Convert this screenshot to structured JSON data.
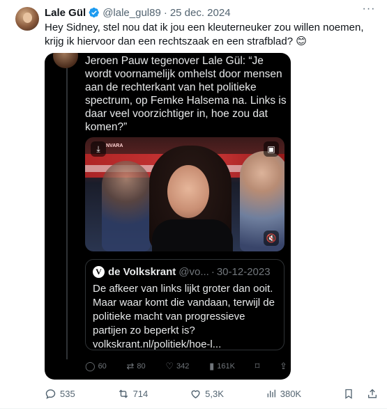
{
  "tweet": {
    "author_name": "Lale Gül",
    "handle": "@lale_gul89",
    "separator": "·",
    "date": "25 dec. 2024",
    "text": "Hey Sidney, stel nou dat ik jou een kleuterneuker zou willen noemen, krijg ik hiervoor dan een rechtszaak en een strafblad? 😊",
    "more_label": "···"
  },
  "embedded": {
    "quote_text": "Jeroen Pauw tegenover Lale Gül: “Je wordt voornamelijk omhelst door mensen aan de rechterkant van het politieke spectrum, op Femke Halsema na. Links is daar veel voorzichtiger in, hoe zou dat komen?”",
    "video": {
      "channel_text": "NVARA"
    },
    "quoted_tweet": {
      "logo_letter": "V",
      "name": "de Volkskrant",
      "handle": "@vo...",
      "separator": "·",
      "date": "30-12-2023",
      "text": "De afkeer van links lijkt groter dan ooit. Maar waar komt die vandaan, terwijl de politieke macht van progressieve partijen zo beperkt is?",
      "link": "volkskrant.nl/politiek/hoe-l..."
    },
    "actions": {
      "replies": "60",
      "reposts": "80",
      "likes": "342",
      "views": "161K"
    }
  },
  "actions": {
    "replies": "535",
    "reposts": "714",
    "likes": "5,3K",
    "views": "380K"
  },
  "colors": {
    "verified": "#1d9bf0",
    "text_primary": "#0f1419",
    "text_secondary": "#536471",
    "media_bg": "#000000"
  }
}
